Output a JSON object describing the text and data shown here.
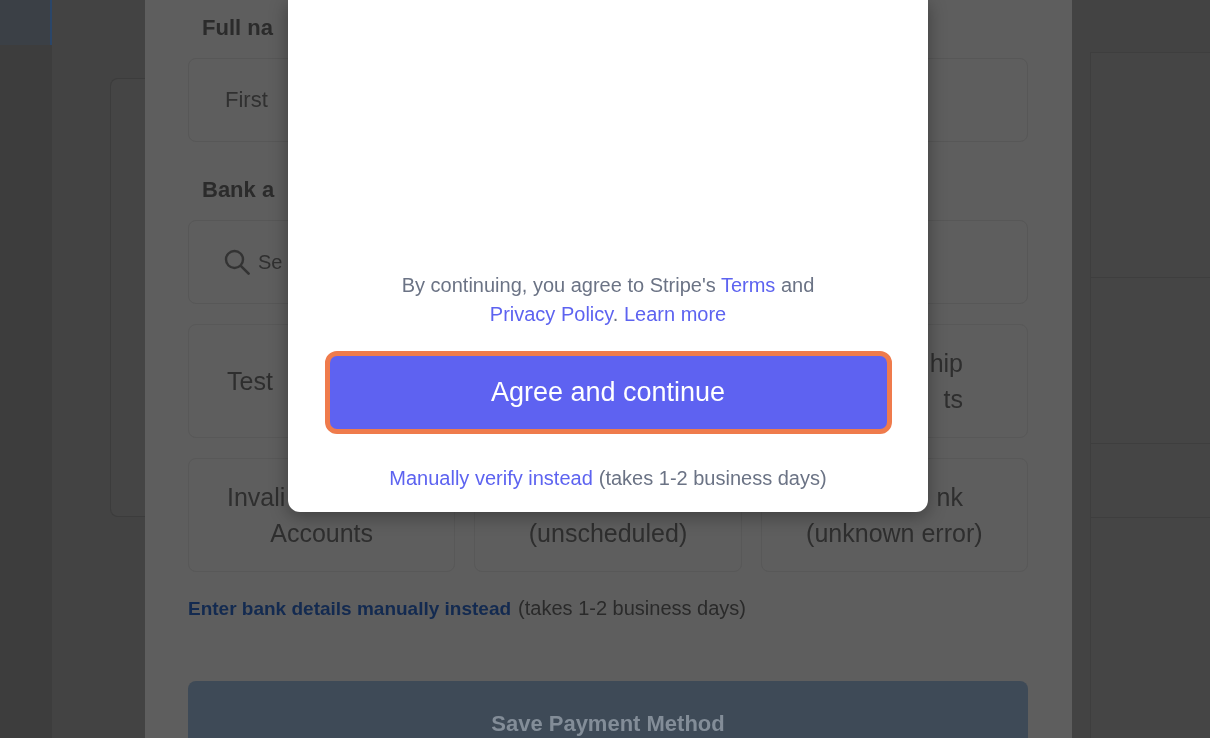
{
  "form": {
    "fields": [
      {
        "kind": "text",
        "label": "Full na",
        "placeholder": "First"
      },
      {
        "kind": "search",
        "label": "Bank a",
        "placeholder": "Se"
      }
    ],
    "bank_tiles": [
      {
        "kind": "plain",
        "lines": [
          {
            "kind": "cut",
            "text": "Test"
          }
        ]
      },
      {
        "kind": "plain",
        "lines": [
          {
            "kind": "tail",
            "text": "hip"
          },
          {
            "kind": "tail",
            "text": "ts"
          }
        ]
      },
      {
        "kind": "plain",
        "lines": [
          {
            "kind": "cut",
            "text": "Invali"
          },
          {
            "kind": "full",
            "text": "Accounts"
          }
        ]
      },
      {
        "kind": "covered",
        "lines": [
          {
            "kind": "full",
            "text": "(unscheduled)"
          }
        ]
      },
      {
        "kind": "plain",
        "lines": [
          {
            "kind": "tail",
            "text": "nk"
          },
          {
            "kind": "full",
            "text": "(unknown error)"
          }
        ]
      }
    ],
    "manual_entry": {
      "link": "Enter bank details manually instead",
      "note": "(takes 1-2 business days)"
    },
    "submit_button": {
      "label": "Save Payment Method",
      "disabled": true
    }
  },
  "modal": {
    "consent": {
      "parts": [
        {
          "kind": "text",
          "text": "By continuing, you agree to Stripe's "
        },
        {
          "kind": "link",
          "text": "Terms"
        },
        {
          "kind": "text",
          "text": " and "
        },
        {
          "kind": "link",
          "text": "Privacy Policy"
        },
        {
          "kind": "text",
          "text": ". "
        },
        {
          "kind": "link",
          "text": "Learn more"
        }
      ]
    },
    "primary_button": {
      "label": "Agree and continue",
      "focused": true
    },
    "manual_verify": {
      "link": "Manually verify instead",
      "note": "(takes 1-2 business days)"
    }
  }
}
